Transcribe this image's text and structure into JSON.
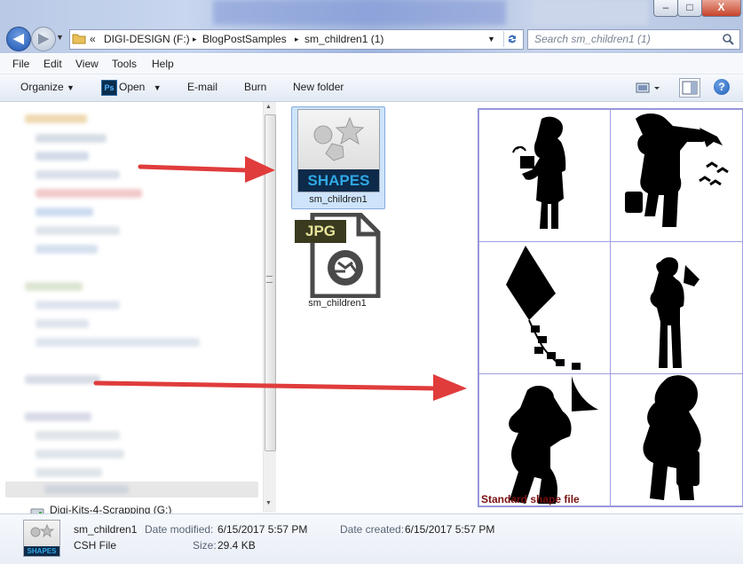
{
  "window": {
    "buttons": {
      "minimize": "–",
      "maximize": "□",
      "close": "X"
    }
  },
  "nav": {
    "back": "◀",
    "forward": "▶"
  },
  "address": {
    "overflow": "«",
    "crumbs": [
      "DIGI-DESIGN (F:)",
      "BlogPostSamples",
      "sm_children1 (1)"
    ],
    "separator": "▸"
  },
  "search": {
    "placeholder": "Search sm_children1 (1)"
  },
  "menu": [
    "File",
    "Edit",
    "View",
    "Tools",
    "Help"
  ],
  "toolbar": {
    "organize": "Organize",
    "open": "Open",
    "open_app_badge": "Ps",
    "email": "E-mail",
    "burn": "Burn",
    "new_folder": "New folder"
  },
  "navpane": {
    "visible_drive": "Digi-Kits-4-Scrapping (G:)"
  },
  "files": [
    {
      "name": "sm_children1",
      "badge": "SHAPES",
      "selected": true
    },
    {
      "name": "sm_children1",
      "badge": "JPG",
      "selected": false
    }
  ],
  "preview": {
    "caption": "Standard shape file"
  },
  "details": {
    "name": "sm_children1",
    "type": "CSH File",
    "thumb_badge": "SHAPES",
    "modified_label": "Date modified:",
    "modified_value": "6/15/2017 5:57 PM",
    "size_label": "Size:",
    "size_value": "29.4 KB",
    "created_label": "Date created:",
    "created_value": "6/15/2017 5:57 PM"
  },
  "colors": {
    "arrow": "#e03c3c",
    "selection": "#cde4fb",
    "shapes_badge": "#0d2a4a",
    "shapes_text": "#2fa8e6"
  }
}
